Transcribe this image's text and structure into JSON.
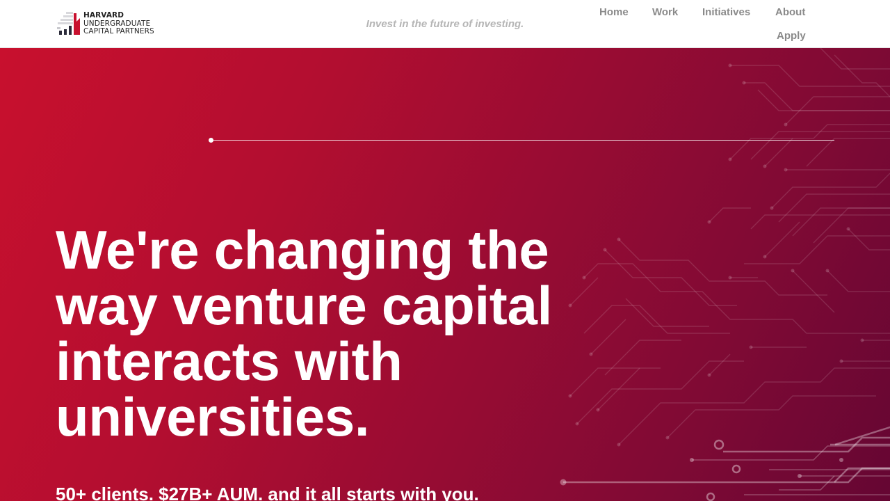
{
  "header": {
    "logo": {
      "line_1": "HARVARD",
      "line_2": "UNDERGRADUATE",
      "line_3": "CAPITAL PARTNERS",
      "icon": "bar-chart-logo-icon"
    },
    "tagline": "Invest in the future of investing.",
    "nav": [
      {
        "label": "Home"
      },
      {
        "label": "Work"
      },
      {
        "label": "Initiatives"
      },
      {
        "label": "About"
      },
      {
        "label": "Apply"
      }
    ]
  },
  "hero": {
    "headline": "We're changing the way venture capital interacts with universities.",
    "stats_line": "50+ clients. $27B+ AUM. and it all starts with you.",
    "background_icon": "circuit-board-pattern"
  },
  "colors": {
    "crimson": "#c8102e",
    "deep_crimson": "#650633",
    "nav_text": "#8a8a8a",
    "tagline_text": "#b5b5b5",
    "white": "#ffffff"
  }
}
